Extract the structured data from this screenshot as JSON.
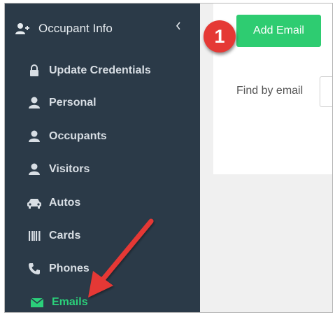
{
  "sidebar": {
    "header": {
      "label": "Occupant Info",
      "icon": "add-user-icon",
      "collapse_icon": "chevron-left-icon"
    },
    "items": [
      {
        "label": "Update Credentials",
        "icon": "lock-icon"
      },
      {
        "label": "Personal",
        "icon": "user-icon"
      },
      {
        "label": "Occupants",
        "icon": "user-icon"
      },
      {
        "label": "Visitors",
        "icon": "user-icon"
      },
      {
        "label": "Autos",
        "icon": "car-icon"
      },
      {
        "label": "Cards",
        "icon": "barcode-icon"
      },
      {
        "label": "Phones",
        "icon": "phone-icon"
      },
      {
        "label": "Emails",
        "icon": "envelope-icon",
        "active": true
      }
    ]
  },
  "main": {
    "add_button_label": "Add Email",
    "find_label": "Find by email",
    "find_value": ""
  },
  "annotation": {
    "step_number": "1"
  },
  "colors": {
    "sidebar_bg": "#2b3a48",
    "active_item": "#2bd07a",
    "add_button": "#2ecc71",
    "badge": "#e53935",
    "arrow": "#e53935"
  }
}
